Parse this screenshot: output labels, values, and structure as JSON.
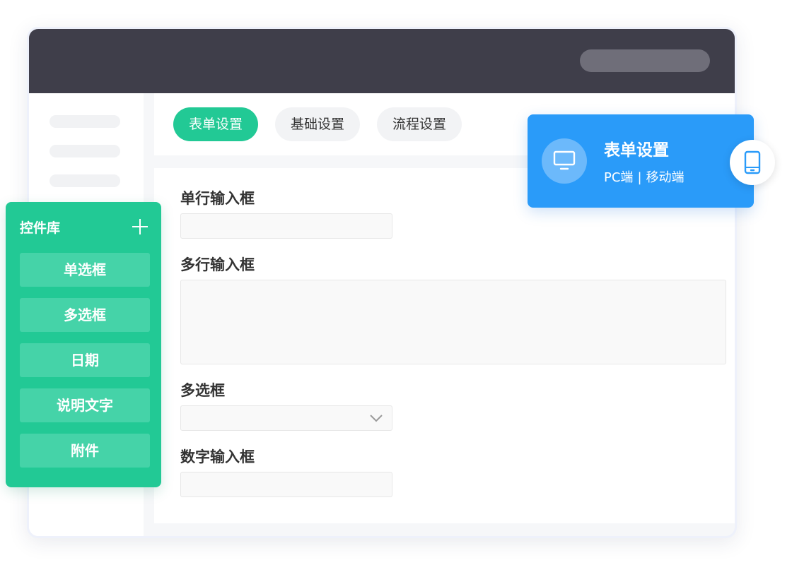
{
  "tabs": [
    {
      "label": "表单设置",
      "active": true
    },
    {
      "label": "基础设置",
      "active": false
    },
    {
      "label": "流程设置",
      "active": false
    }
  ],
  "form": {
    "fields": [
      {
        "label": "单行输入框",
        "type": "text"
      },
      {
        "label": "多行输入框",
        "type": "textarea"
      },
      {
        "label": "多选框",
        "type": "select"
      },
      {
        "label": "数字输入框",
        "type": "number"
      }
    ]
  },
  "library": {
    "title": "控件库",
    "items": [
      "单选框",
      "多选框",
      "日期",
      "说明文字",
      "附件"
    ]
  },
  "card": {
    "title": "表单设置",
    "pc_label": "PC端",
    "separator": "|",
    "mobile_label": "移动端"
  },
  "colors": {
    "header": "#3f3e4a",
    "accent_green": "#22c995",
    "accent_blue": "#2a9bf9"
  },
  "icons": [
    "plus-icon",
    "monitor-icon",
    "tablet-icon",
    "chevron-down-icon"
  ]
}
